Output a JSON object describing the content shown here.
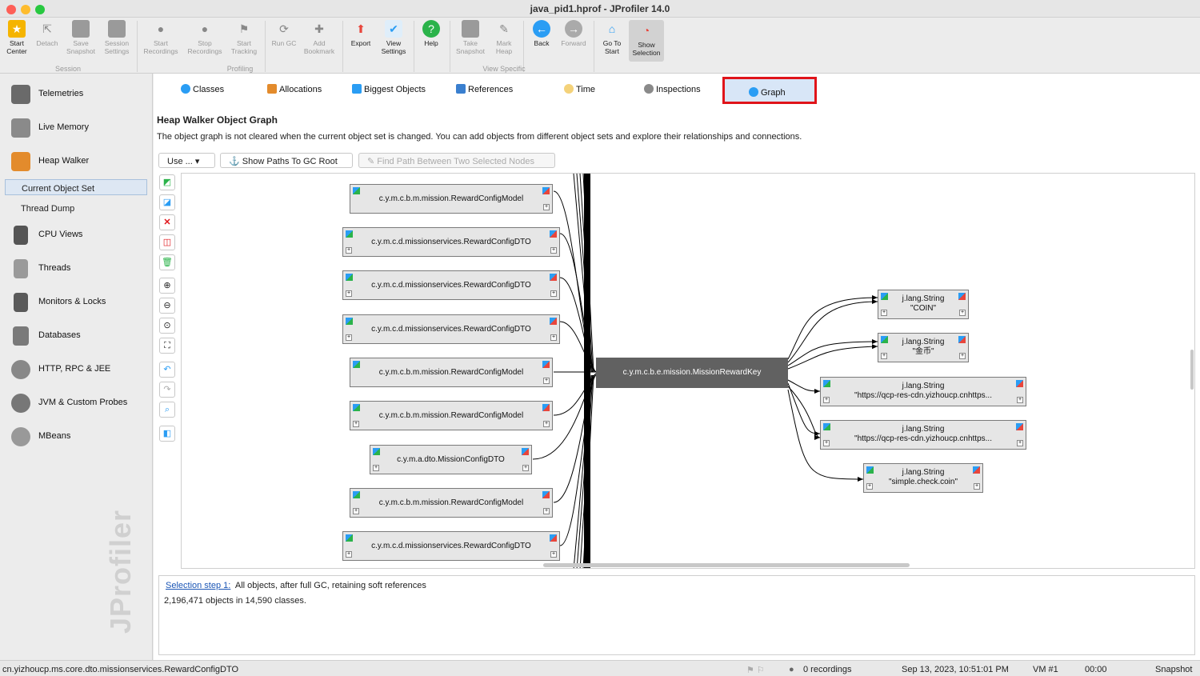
{
  "window": {
    "title": "java_pid1.hprof - JProfiler 14.0"
  },
  "toolbar": {
    "items": [
      {
        "label": "Start Center",
        "icon": "folder-star-icon"
      },
      {
        "label": "Detach",
        "icon": "detach-icon"
      },
      {
        "label": "Save Snapshot",
        "icon": "save-icon"
      },
      {
        "label": "Session Settings",
        "icon": "settings-icon"
      },
      {
        "label": "Start Recordings",
        "icon": "start-recordings-icon"
      },
      {
        "label": "Stop Recordings",
        "icon": "stop-recordings-icon"
      },
      {
        "label": "Start Tracking",
        "icon": "tracking-icon"
      },
      {
        "label": "Run GC",
        "icon": "gc-icon"
      },
      {
        "label": "Add Bookmark",
        "icon": "bookmark-icon"
      },
      {
        "label": "Export",
        "icon": "export-icon"
      },
      {
        "label": "View Settings",
        "icon": "view-settings-icon"
      },
      {
        "label": "Help",
        "icon": "help-icon"
      },
      {
        "label": "Take Snapshot",
        "icon": "camera-icon"
      },
      {
        "label": "Mark Heap",
        "icon": "pin-icon"
      },
      {
        "label": "Back",
        "icon": "back-icon"
      },
      {
        "label": "Forward",
        "icon": "forward-icon"
      },
      {
        "label": "Go To Start",
        "icon": "home-icon"
      },
      {
        "label": "Show Selection",
        "icon": "show-selection-icon"
      }
    ],
    "groups": {
      "session": "Session",
      "profiling": "Profiling",
      "view_specific": "View Specific"
    }
  },
  "sidebar": {
    "items": [
      {
        "label": "Telemetries"
      },
      {
        "label": "Live Memory"
      },
      {
        "label": "Heap Walker"
      },
      {
        "label": "CPU Views"
      },
      {
        "label": "Threads"
      },
      {
        "label": "Monitors & Locks"
      },
      {
        "label": "Databases"
      },
      {
        "label": "HTTP, RPC & JEE"
      },
      {
        "label": "JVM & Custom Probes"
      },
      {
        "label": "MBeans"
      }
    ],
    "sub": {
      "current": "Current Object Set",
      "thread_dump": "Thread Dump"
    },
    "watermark": "JProfiler"
  },
  "tabs": [
    "Classes",
    "Allocations",
    "Biggest Objects",
    "References",
    "Time",
    "Inspections",
    "Graph"
  ],
  "main": {
    "heading": "Heap Walker Object Graph",
    "description": "The object graph is not cleared when the current object set is changed. You can add objects from different object sets and explore their relationships and connections.",
    "use_btn": "Use ...",
    "paths_btn": "Show Paths To GC Root",
    "find_btn": "Find Path Between Two Selected Nodes"
  },
  "graph": {
    "left_nodes": [
      "c.y.m.c.b.m.mission.RewardConfigModel",
      "c.y.m.c.d.missionservices.RewardConfigDTO",
      "c.y.m.c.d.missionservices.RewardConfigDTO",
      "c.y.m.c.d.missionservices.RewardConfigDTO",
      "c.y.m.c.b.m.mission.RewardConfigModel",
      "c.y.m.c.b.m.mission.RewardConfigModel",
      "c.y.m.a.dto.MissionConfigDTO",
      "c.y.m.c.b.m.mission.RewardConfigModel",
      "c.y.m.c.d.missionservices.RewardConfigDTO"
    ],
    "center": "c.y.m.c.b.e.mission.MissionRewardKey",
    "right_nodes": [
      {
        "type": "j.lang.String",
        "value": "\"COIN\""
      },
      {
        "type": "j.lang.String",
        "value": "\"金币\""
      },
      {
        "type": "j.lang.String",
        "value": "\"https://qcp-res-cdn.yizhoucp.cnhttps..."
      },
      {
        "type": "j.lang.String",
        "value": "\"https://qcp-res-cdn.yizhoucp.cnhttps..."
      },
      {
        "type": "j.lang.String",
        "value": "\"simple.check.coin\""
      }
    ]
  },
  "selection": {
    "link": "Selection step 1:",
    "text": "All objects, after full GC, retaining soft references",
    "count": "2,196,471 objects in 14,590 classes."
  },
  "status": {
    "left": "cn.yizhoucp.ms.core.dto.missionservices.RewardConfigDTO",
    "recordings": "0 recordings",
    "datetime": "Sep 13, 2023, 10:51:01 PM",
    "vm": "VM #1",
    "time": "00:00",
    "snapshot": "Snapshot"
  },
  "colors": {
    "highlight": "#e0141a",
    "center_node": "#616161"
  }
}
